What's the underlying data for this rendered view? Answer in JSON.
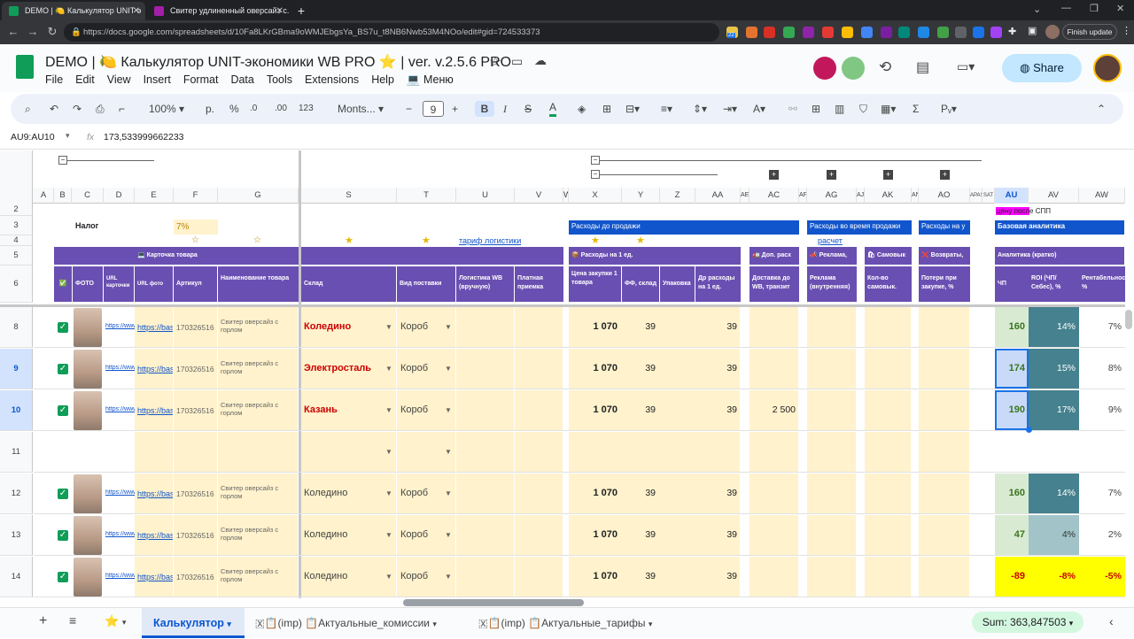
{
  "browser": {
    "tabs": [
      {
        "label": "DEMO | 🍋 Калькулятор UNIT-э"
      },
      {
        "label": "Свитер удлиненный оверсайз с..."
      }
    ],
    "url": "https://docs.google.com/spreadsheets/d/10Fa8LKrGBma9oWMJEbgsYa_BS7u_t8NB6Nwb53M4NOo/edit#gid=724533373",
    "finish_update": "Finish update",
    "ext_badge": "22"
  },
  "doc": {
    "title": "DEMO | 🍋 Калькулятор  UNIT-экономики WB PRO ⭐ | ver. v.2.5.6 PRO",
    "menu": [
      "File",
      "Edit",
      "View",
      "Insert",
      "Format",
      "Data",
      "Tools",
      "Extensions",
      "Help",
      "Меню"
    ],
    "share": "Share"
  },
  "toolbar": {
    "zoom": "100%",
    "currency": "р.",
    "percent": "%",
    "dec_dec": ".0",
    "dec_inc": ".00",
    "format_123": "123",
    "font": "Monts...",
    "font_size": "9"
  },
  "formula": {
    "name_box": "AU9:AU10",
    "fx": "fx",
    "value": "173,533999662233"
  },
  "columns": [
    "A",
    "B",
    "C",
    "D",
    "E",
    "F",
    "G",
    "S",
    "T",
    "U",
    "V",
    "W",
    "X",
    "Y",
    "Z",
    "AA",
    "AE",
    "AC",
    "AF",
    "AG",
    "AJ",
    "AK",
    "AN",
    "AO",
    "APAS",
    "SAT",
    "AU",
    "AV",
    "AW"
  ],
  "header": {
    "nalog": "Налог",
    "nalog_val": "7%",
    "tarif": "тариф логистики",
    "raschet": "расчет",
    "cpp": "цену после СПП",
    "blue": [
      "Расходы до продажи",
      "Расходы во время продажи",
      "Расходы на у",
      "Базовая аналитика"
    ],
    "sections": [
      "💻 Карточка товара",
      "📦 Расходы на 1 ед.",
      "🚛 Доп. расх",
      "📣 Реклама,",
      "🛍 Самовык",
      "❌ Возвраты,",
      "Аналитика (кратко)"
    ],
    "subheads": [
      "✅",
      "ФОТО",
      "URL карточки",
      "URL фото",
      "Артикул",
      "Наименование товара",
      "Склад",
      "Вид поставки",
      "Логистика WB (вручную)",
      "Платная приемка",
      "Цена закупки 1 товара",
      "ФФ, склад",
      "Упаковка",
      "Др расходы на 1 ед.",
      "Доставка до WB, транзит",
      "Реклама (внутренняя)",
      "Кол-во самовык.",
      "Потери при закупке, %",
      "ЧП",
      "ROI (ЧП/Себес), %",
      "Рентабельность, %"
    ]
  },
  "rows": [
    {
      "n": "8",
      "check": true,
      "link": "https://www",
      "foto": "https://bas",
      "art": "170326516",
      "name": "Свитер оверсайз с горлом",
      "sklad": "Коледино",
      "red": true,
      "vid": "Короб",
      "price": "1 070",
      "ff": "39",
      "dr": "39",
      "dost": "",
      "chp": "160",
      "roi": "14%",
      "rent": "7%",
      "style": "g"
    },
    {
      "n": "9",
      "check": true,
      "link": "https://www",
      "foto": "https://bas",
      "art": "170326516",
      "name": "Свитер оверсайз с горлом",
      "sklad": "Электросталь",
      "red": true,
      "vid": "Короб",
      "price": "1 070",
      "ff": "39",
      "dr": "39",
      "dost": "",
      "chp": "174",
      "roi": "15%",
      "rent": "8%",
      "style": "g"
    },
    {
      "n": "10",
      "check": true,
      "link": "https://www",
      "foto": "https://bas",
      "art": "170326516",
      "name": "Свитер оверсайз с горлом",
      "sklad": "Казань",
      "red": true,
      "vid": "Короб",
      "price": "1 070",
      "ff": "39",
      "dr": "39",
      "dost": "2 500",
      "chp": "190",
      "roi": "17%",
      "rent": "9%",
      "style": "g"
    },
    {
      "n": "11",
      "check": false,
      "link": "",
      "foto": "",
      "art": "",
      "name": "",
      "sklad": "",
      "red": false,
      "vid": "",
      "price": "",
      "ff": "",
      "dr": "",
      "dost": "",
      "chp": "",
      "roi": "",
      "rent": "",
      "style": "e"
    },
    {
      "n": "12",
      "check": true,
      "link": "https://www",
      "foto": "https://bas",
      "art": "170326516",
      "name": "Свитер оверсайз с горлом",
      "sklad": "Коледино",
      "red": false,
      "vid": "Короб",
      "price": "1 070",
      "ff": "39",
      "dr": "39",
      "dost": "",
      "chp": "160",
      "roi": "14%",
      "rent": "7%",
      "style": "g"
    },
    {
      "n": "13",
      "check": true,
      "link": "https://www",
      "foto": "https://bas",
      "art": "170326516",
      "name": "Свитер оверсайз с горлом",
      "sklad": "Коледино",
      "red": false,
      "vid": "Короб",
      "price": "1 070",
      "ff": "39",
      "dr": "39",
      "dost": "",
      "chp": "47",
      "roi": "4%",
      "rent": "2%",
      "style": "l"
    },
    {
      "n": "14",
      "check": true,
      "link": "https://www",
      "foto": "https://bas",
      "art": "170326516",
      "name": "Свитер оверсайз с горлом",
      "sklad": "Коледино",
      "red": false,
      "vid": "Короб",
      "price": "1 070",
      "ff": "39",
      "dr": "39",
      "dost": "",
      "chp": "-89",
      "roi": "-8%",
      "rent": "-5%",
      "style": "y"
    }
  ],
  "sheets": {
    "star": "⭐",
    "active": "Калькулятор",
    "s2": "🇽📋(imp) 📋Актуальные_комиссии",
    "s3": "🇽📋(imp) 📋Актуальные_тарифы",
    "sum": "Sum: 363,847503"
  },
  "colors": {
    "purple": "#6a4fb2",
    "blue": "#1155cc",
    "cream": "#fff2cc",
    "green": "#0f9d58"
  }
}
